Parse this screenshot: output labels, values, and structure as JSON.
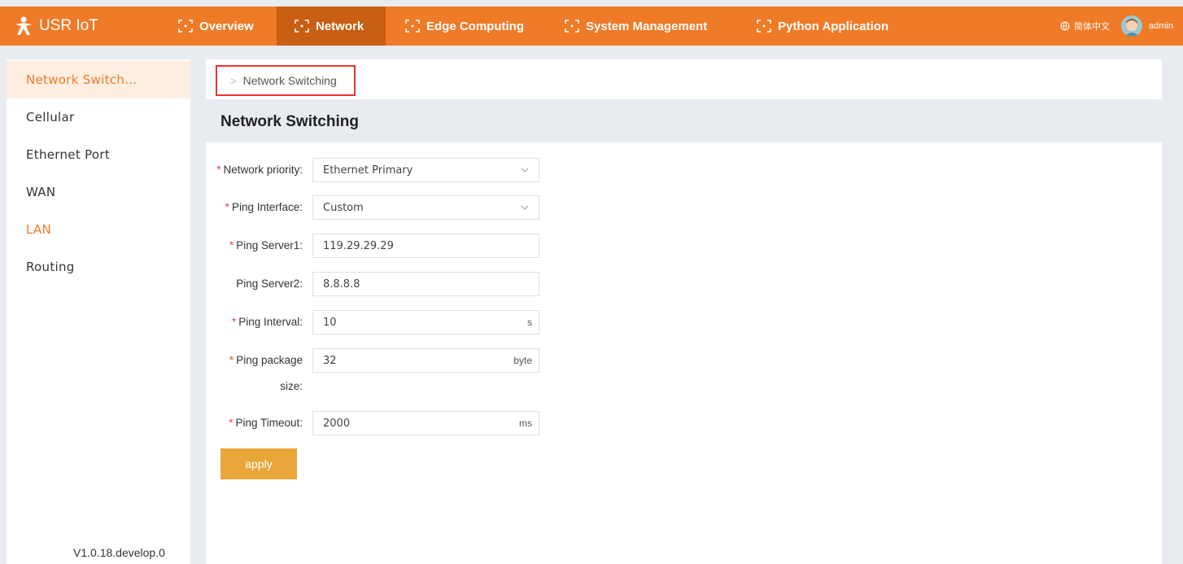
{
  "app": {
    "logo_text": "USR IoT"
  },
  "nav": {
    "items": [
      {
        "label": "Overview"
      },
      {
        "label": "Network"
      },
      {
        "label": "Edge Computing"
      },
      {
        "label": "System Management"
      },
      {
        "label": "Python Application"
      }
    ],
    "active_index": 1,
    "language": "简体中文",
    "user": "admin"
  },
  "sidebar": {
    "items": [
      {
        "label": "Network Switch..."
      },
      {
        "label": "Cellular"
      },
      {
        "label": "Ethernet Port"
      },
      {
        "label": "WAN"
      },
      {
        "label": "LAN"
      },
      {
        "label": "Routing"
      }
    ],
    "version": "V1.0.18.develop.0"
  },
  "breadcrumb": {
    "label": "Network Switching"
  },
  "page": {
    "title": "Network Switching"
  },
  "form": {
    "network_priority": {
      "label": "Network priority:",
      "value": "Ethernet Primary"
    },
    "ping_interface": {
      "label": "Ping Interface:",
      "value": "Custom"
    },
    "ping_server1": {
      "label": "Ping Server1:",
      "value": "119.29.29.29"
    },
    "ping_server2": {
      "label": "Ping Server2:",
      "value": "8.8.8.8"
    },
    "ping_interval": {
      "label": "Ping Interval:",
      "value": "10",
      "unit": "s"
    },
    "ping_package_size": {
      "label_line1": "Ping package",
      "label_line2": "size:",
      "value": "32",
      "unit": "byte"
    },
    "ping_timeout": {
      "label": "Ping Timeout:",
      "value": "2000",
      "unit": "ms"
    },
    "required_mark": "*",
    "apply_label": "apply"
  },
  "colors": {
    "accent": "#ef7a27",
    "nav_active": "#c85f12",
    "apply": "#e9a73a",
    "required": "#f04040"
  }
}
